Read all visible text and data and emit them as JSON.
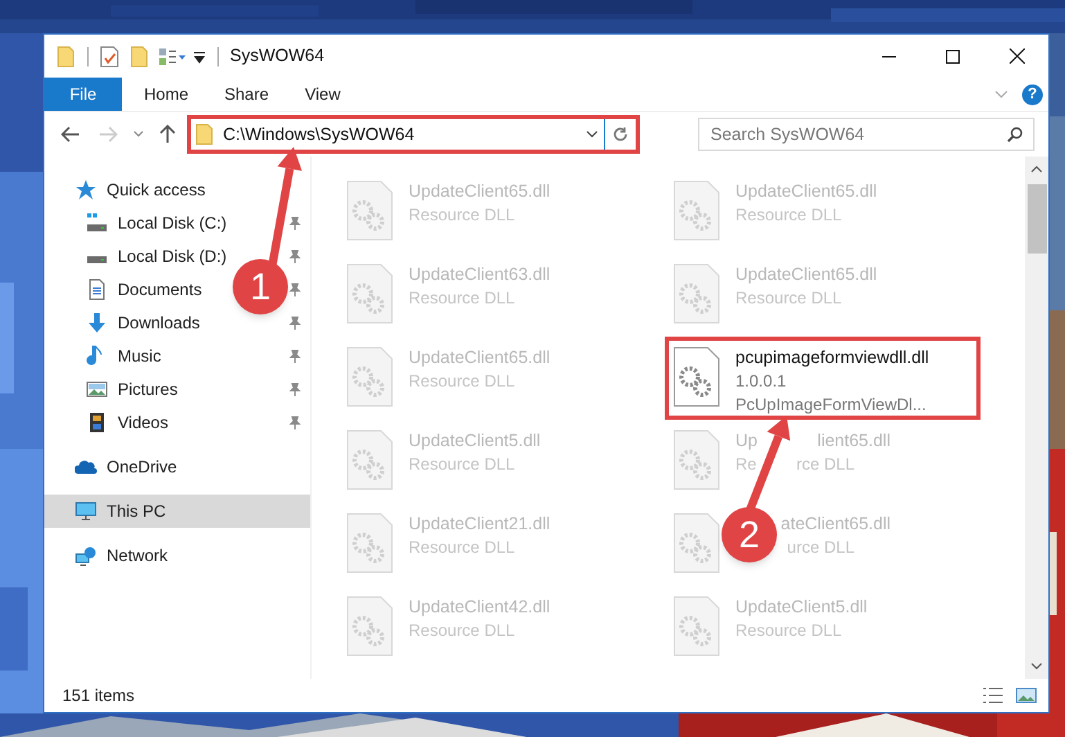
{
  "window": {
    "title": "SysWOW64"
  },
  "ribbon_tabs": [
    {
      "label": "File",
      "selected": true
    },
    {
      "label": "Home",
      "selected": false
    },
    {
      "label": "Share",
      "selected": false
    },
    {
      "label": "View",
      "selected": false
    }
  ],
  "help": {
    "glyph": "?"
  },
  "address": {
    "value": "C:\\Windows\\SysWOW64",
    "highlighted": true
  },
  "search": {
    "placeholder": "Search SysWOW64"
  },
  "sidebar": {
    "items": [
      {
        "label": "Quick access",
        "kind": "quick",
        "pinned": false,
        "selected": false,
        "children": [
          {
            "label": "Local Disk (C:)",
            "kind": "disk-c",
            "pinned": true,
            "selected": false
          },
          {
            "label": "Local Disk (D:)",
            "kind": "disk",
            "pinned": true,
            "selected": false
          },
          {
            "label": "Documents",
            "kind": "documents",
            "pinned": true,
            "selected": false
          },
          {
            "label": "Downloads",
            "kind": "downloads",
            "pinned": true,
            "selected": false
          },
          {
            "label": "Music",
            "kind": "music",
            "pinned": true,
            "selected": false
          },
          {
            "label": "Pictures",
            "kind": "pictures",
            "pinned": true,
            "selected": false
          },
          {
            "label": "Videos",
            "kind": "videos",
            "pinned": true,
            "selected": false
          }
        ]
      },
      {
        "label": "OneDrive",
        "kind": "onedrive",
        "pinned": false,
        "selected": false
      },
      {
        "label": "This PC",
        "kind": "pc",
        "pinned": false,
        "selected": true
      },
      {
        "label": "Network",
        "kind": "network",
        "pinned": false,
        "selected": false
      }
    ]
  },
  "files": [
    {
      "name": [
        "UpdateClient65.dll"
      ],
      "details": [
        [
          "Resource DLL"
        ]
      ],
      "kind": "blurred",
      "highlighted": false,
      "leading_hidden": false
    },
    {
      "name": [
        "UpdateClient65.dll"
      ],
      "details": [
        [
          "Resource DLL"
        ]
      ],
      "kind": "blurred",
      "highlighted": false,
      "leading_hidden": false
    },
    {
      "name": [
        "UpdateClient63.dll"
      ],
      "details": [
        [
          "Resource DLL"
        ]
      ],
      "kind": "blurred",
      "highlighted": false,
      "leading_hidden": false
    },
    {
      "name": [
        "UpdateClient65.dll"
      ],
      "details": [
        [
          "Resource DLL"
        ]
      ],
      "kind": "blurred",
      "highlighted": false,
      "leading_hidden": false
    },
    {
      "name": [
        "UpdateClient65.dll"
      ],
      "details": [
        [
          "Resource DLL"
        ]
      ],
      "kind": "blurred",
      "highlighted": false,
      "leading_hidden": false
    },
    {
      "name": [
        "pcupimageformviewdll.dll"
      ],
      "details": [
        [
          "1.0.0.1"
        ],
        [
          "PcUpImageFormViewDl..."
        ]
      ],
      "kind": "sharp",
      "highlighted": true,
      "leading_hidden": false
    },
    {
      "name": [
        "UpdateClient5.dll"
      ],
      "details": [
        [
          "Resource DLL"
        ]
      ],
      "kind": "blurred",
      "highlighted": false,
      "leading_hidden": false
    },
    {
      "name": [
        "Up",
        "lient65.dll"
      ],
      "details": [
        [
          "Re",
          "rce DLL"
        ]
      ],
      "kind": "blurred",
      "highlighted": false,
      "leading_hidden": false
    },
    {
      "name": [
        "UpdateClient21.dll"
      ],
      "details": [
        [
          "Resource DLL"
        ]
      ],
      "kind": "blurred",
      "highlighted": false,
      "leading_hidden": false
    },
    {
      "name": [
        "ateClient65.dll"
      ],
      "details": [
        [
          "urce DLL"
        ]
      ],
      "kind": "blurred",
      "highlighted": false,
      "leading_hidden": true
    },
    {
      "name": [
        "UpdateClient42.dll"
      ],
      "details": [
        [
          "Resource DLL"
        ]
      ],
      "kind": "blurred",
      "highlighted": false,
      "leading_hidden": false
    },
    {
      "name": [
        "UpdateClient5.dll"
      ],
      "details": [
        [
          "Resource DLL"
        ]
      ],
      "kind": "blurred",
      "highlighted": false,
      "leading_hidden": false
    }
  ],
  "callouts": [
    {
      "label": "1"
    },
    {
      "label": "2"
    }
  ],
  "status_bar": {
    "count": "151 items"
  }
}
